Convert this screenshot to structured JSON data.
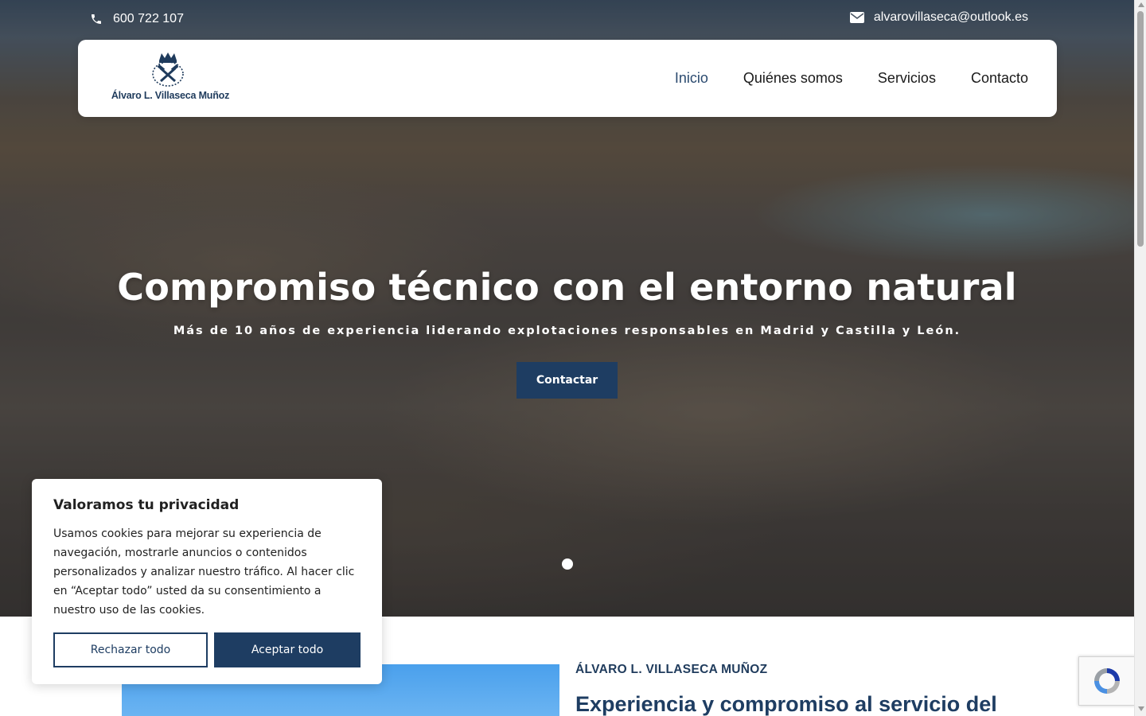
{
  "topbar": {
    "phone": "600 722 107",
    "email": "alvarovillaseca@outlook.es"
  },
  "header": {
    "logo_text": "Álvaro L. Villaseca Muñoz",
    "nav": [
      {
        "label": "Inicio",
        "active": true
      },
      {
        "label": "Quiénes somos",
        "active": false
      },
      {
        "label": "Servicios",
        "active": false
      },
      {
        "label": "Contacto",
        "active": false
      }
    ]
  },
  "hero": {
    "title": "Compromiso técnico con el entorno natural",
    "subtitle": "Más de 10 años de experiencia liderando explotaciones responsables en Madrid y Castilla y León.",
    "cta_label": "Contactar",
    "slides_total": 1,
    "slide_active": 1
  },
  "about": {
    "kicker": "ÁLVARO L. VILLASECA MUÑOZ",
    "title": "Experiencia y compromiso al servicio del"
  },
  "cookie_banner": {
    "title": "Valoramos tu privacidad",
    "text": "Usamos cookies para mejorar su experiencia de navegación, mostrarle anuncios o contenidos personalizados y analizar nuestro tráfico. Al hacer clic en “Aceptar todo” usted da su consentimiento a nuestro uso de las cookies.",
    "reject_label": "Rechazar todo",
    "accept_label": "Aceptar todo"
  },
  "colors": {
    "brand_navy": "#1e3d62",
    "text_dark": "#212121",
    "white": "#ffffff",
    "about_image_sky": "#4aa0ec"
  },
  "icons": {
    "phone": "phone-icon",
    "email": "envelope-icon",
    "logo": "crown-crossed-hammers-emblem",
    "recaptcha": "recaptcha-logo"
  }
}
